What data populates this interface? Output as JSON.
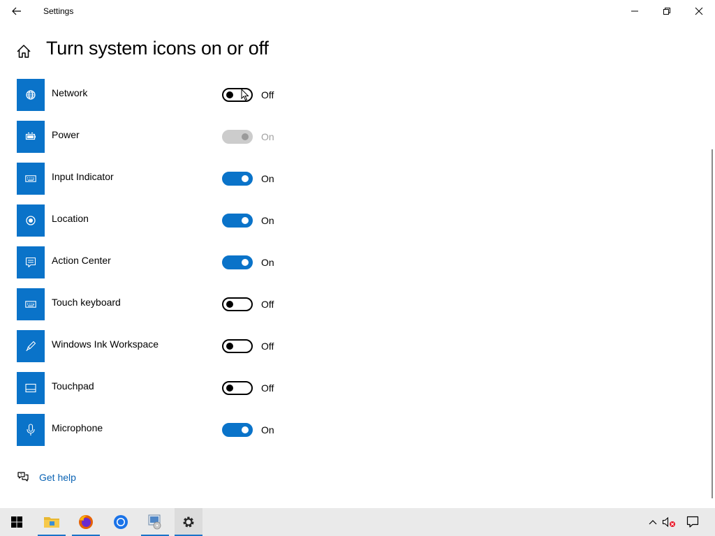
{
  "window": {
    "title": "Settings"
  },
  "header": {
    "page_title": "Turn system icons on or off"
  },
  "settings": [
    {
      "label": "Network",
      "state": "Off",
      "icon": "globe-icon"
    },
    {
      "label": "Power",
      "state": "On",
      "icon": "battery-icon",
      "disabled": true
    },
    {
      "label": "Input Indicator",
      "state": "On",
      "icon": "keyboard-icon"
    },
    {
      "label": "Location",
      "state": "On",
      "icon": "location-icon"
    },
    {
      "label": "Action Center",
      "state": "On",
      "icon": "action-center-icon"
    },
    {
      "label": "Touch keyboard",
      "state": "Off",
      "icon": "keyboard-icon"
    },
    {
      "label": "Windows Ink Workspace",
      "state": "Off",
      "icon": "pen-icon"
    },
    {
      "label": "Touchpad",
      "state": "Off",
      "icon": "touchpad-icon"
    },
    {
      "label": "Microphone",
      "state": "On",
      "icon": "microphone-icon"
    }
  ],
  "help": {
    "link_label": "Get help"
  },
  "colors": {
    "accent": "#0a73c9",
    "link": "#0a63b4",
    "disabled": "#a0a0a0"
  },
  "taskbar": {
    "apps": [
      "start-icon",
      "file-explorer-icon",
      "firefox-icon",
      "chrome-icon",
      "installer-icon",
      "settings-icon"
    ],
    "tray": [
      "chevron-up-icon",
      "volume-muted-icon",
      "notifications-icon"
    ]
  }
}
